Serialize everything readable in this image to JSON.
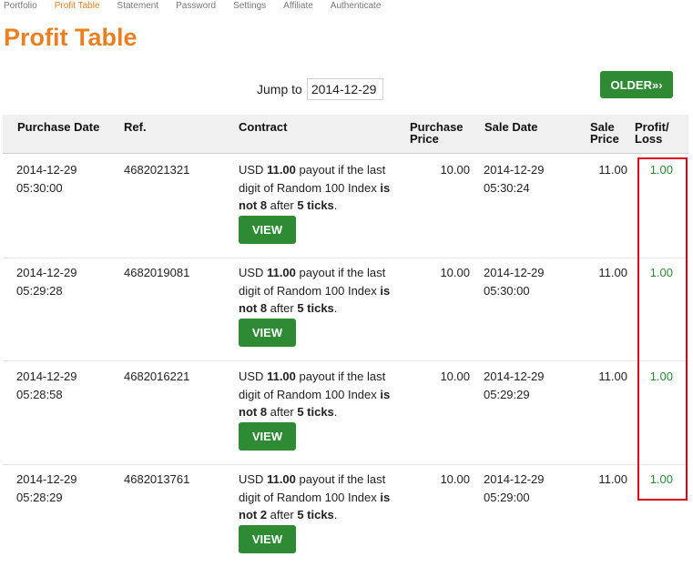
{
  "nav": {
    "items": [
      {
        "label": "Portfolio",
        "active": false
      },
      {
        "label": "Profit Table",
        "active": true
      },
      {
        "label": "Statement",
        "active": false
      },
      {
        "label": "Password",
        "active": false
      },
      {
        "label": "Settings",
        "active": false
      },
      {
        "label": "Affiliate",
        "active": false
      },
      {
        "label": "Authenticate",
        "active": false
      }
    ]
  },
  "page": {
    "title": "Profit Table"
  },
  "jump": {
    "label": "Jump to",
    "value": "2014-12-29"
  },
  "buttons": {
    "older": "OLDER»›"
  },
  "table": {
    "headers": {
      "purchase_date": "Purchase Date",
      "ref": "Ref.",
      "contract": "Contract",
      "purchase_price": [
        "Purchase",
        "Price"
      ],
      "sale_date": "Sale Date",
      "sale_price": [
        "Sale",
        "Price"
      ],
      "profit_loss": [
        "Profit/",
        "Loss"
      ]
    },
    "view_label": "VIEW",
    "rows": [
      {
        "purchase_date": "2014-12-29",
        "purchase_time": "05:30:00",
        "ref": "4682021321",
        "contract": {
          "currency": "USD",
          "payout": "11.00",
          "text1": " payout if the last digit of Random 100 Index ",
          "cond": "is not 8",
          "text2": " after ",
          "ticks": "5 ticks",
          "end": "."
        },
        "purchase_price": "10.00",
        "sale_date": "2014-12-29",
        "sale_time": "05:30:24",
        "sale_price": "11.00",
        "profit_loss": "1.00"
      },
      {
        "purchase_date": "2014-12-29",
        "purchase_time": "05:29:28",
        "ref": "4682019081",
        "contract": {
          "currency": "USD",
          "payout": "11.00",
          "text1": " payout if the last digit of Random 100 Index ",
          "cond": "is not 8",
          "text2": " after ",
          "ticks": "5 ticks",
          "end": "."
        },
        "purchase_price": "10.00",
        "sale_date": "2014-12-29",
        "sale_time": "05:30:00",
        "sale_price": "11.00",
        "profit_loss": "1.00"
      },
      {
        "purchase_date": "2014-12-29",
        "purchase_time": "05:28:58",
        "ref": "4682016221",
        "contract": {
          "currency": "USD",
          "payout": "11.00",
          "text1": " payout if the last digit of Random 100 Index ",
          "cond": "is not 8",
          "text2": " after ",
          "ticks": "5 ticks",
          "end": "."
        },
        "purchase_price": "10.00",
        "sale_date": "2014-12-29",
        "sale_time": "05:29:29",
        "sale_price": "11.00",
        "profit_loss": "1.00"
      },
      {
        "purchase_date": "2014-12-29",
        "purchase_time": "05:28:29",
        "ref": "4682013761",
        "contract": {
          "currency": "USD",
          "payout": "11.00",
          "text1": " payout if the last digit of Random 100 Index ",
          "cond": "is not 2",
          "text2": " after ",
          "ticks": "5 ticks",
          "end": "."
        },
        "purchase_price": "10.00",
        "sale_date": "2014-12-29",
        "sale_time": "05:29:00",
        "sale_price": "11.00",
        "profit_loss": "1.00"
      }
    ]
  },
  "colors": {
    "accent": "#e98024",
    "button": "#2e8b34",
    "profit": "#2e8b34",
    "highlight": "#e0001b"
  }
}
